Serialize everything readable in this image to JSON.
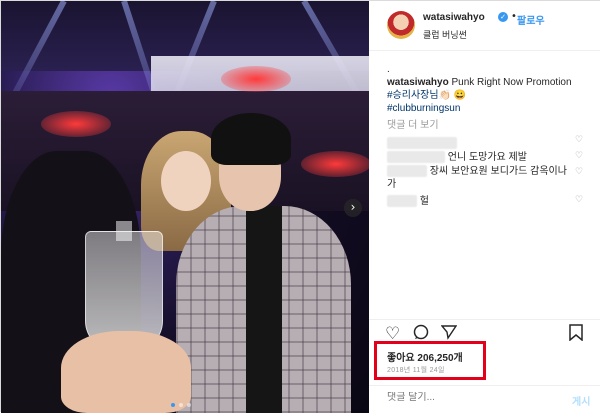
{
  "post": {
    "username": "watasiwahyo",
    "follow_label": "팔로우",
    "separator": "•",
    "location": "클럽 버닝썬",
    "caption": {
      "dot": ".",
      "user": "watasiwahyo",
      "text": "Punk Right Now Promotion",
      "hashtag1": "#승리사장님👏🏻 😀",
      "hashtag2": "#clubburningsun"
    },
    "view_more_comments": "댓글 더 보기",
    "comments": [
      {
        "text": "언니 도망가요 제발"
      },
      {
        "text": "장씨 보안요원 보디가드 감옥이나"
      },
      {
        "text": "가"
      },
      {
        "text": "헐"
      }
    ],
    "likes": "좋아요 206,250개",
    "date": "2018년 11월 24일",
    "comment_placeholder": "댓글 달기...",
    "post_label": "게시"
  },
  "icons": {
    "heart": "heart-icon",
    "comment": "comment-icon",
    "share": "share-icon",
    "bookmark": "bookmark-icon",
    "verified": "verified-badge-icon",
    "next": "chevron-right-icon"
  },
  "colors": {
    "link_blue": "#3897f0",
    "highlight_red": "#e3001b",
    "hashtag": "#003569"
  }
}
